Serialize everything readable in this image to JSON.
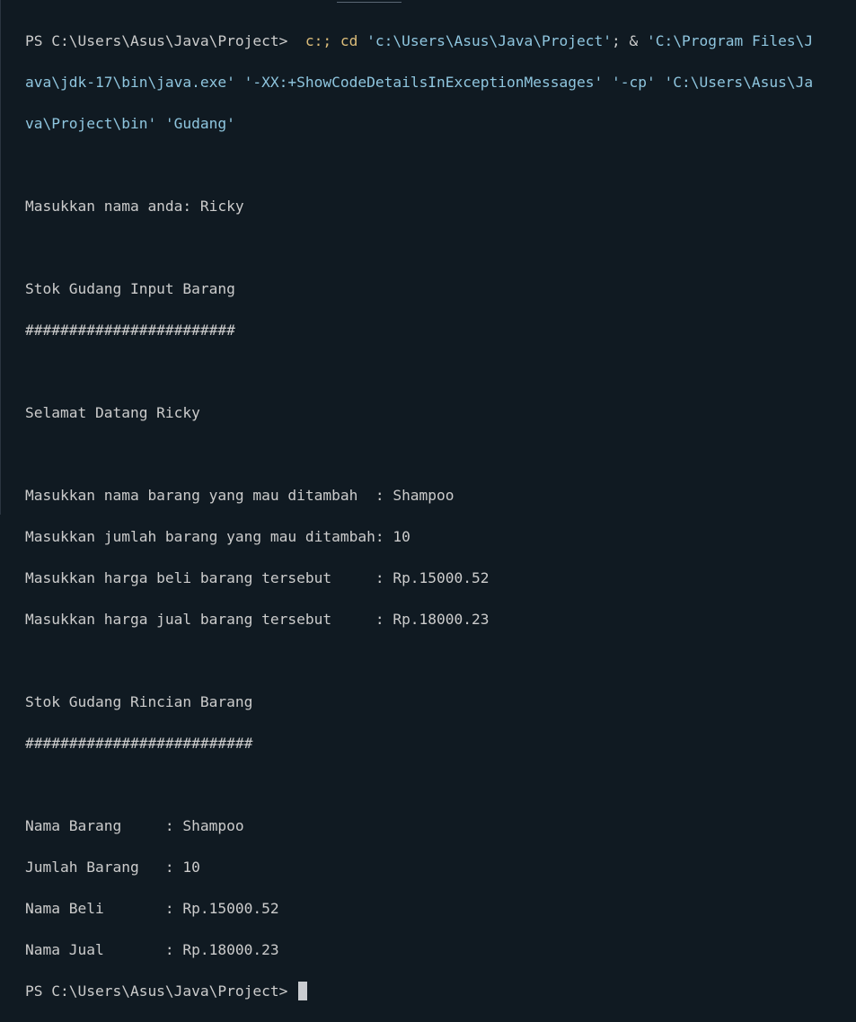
{
  "command": {
    "prompt": "PS C:\\Users\\Asus\\Java\\Project> ",
    "line1": {
      "cmd": " c:; cd",
      "s1": " 'c:\\Users\\Asus\\Java\\Project'",
      "amp": "; &",
      "s2": " 'C:\\Program Files\\J"
    },
    "line2": {
      "s1": "ava\\jdk-17\\bin\\java.exe'",
      "s2": " '-XX:+ShowCodeDetailsInExceptionMessages'",
      "s3": " '-cp'",
      "s4": " 'C:\\Users\\Asus\\Ja"
    },
    "line3": {
      "s1": "va\\Project\\bin'",
      "s2": " 'Gudang'"
    }
  },
  "output": {
    "name_prompt": "Masukkan nama anda: Ricky",
    "input_title": "Stok Gudang Input Barang",
    "input_hashes": "########################",
    "welcome": "Selamat Datang Ricky",
    "input_name": "Masukkan nama barang yang mau ditambah  : Shampoo",
    "input_qty": "Masukkan jumlah barang yang mau ditambah: 10",
    "input_buy": "Masukkan harga beli barang tersebut     : Rp.15000.52",
    "input_sell": "Masukkan harga jual barang tersebut     : Rp.18000.23",
    "detail_title": "Stok Gudang Rincian Barang",
    "detail_hashes": "##########################",
    "detail_name": "Nama Barang     : Shampoo",
    "detail_qty": "Jumlah Barang   : 10",
    "detail_buy": "Nama Beli       : Rp.15000.52",
    "detail_sell": "Nama Jual       : Rp.18000.23",
    "final_prompt": "PS C:\\Users\\Asus\\Java\\Project> "
  }
}
